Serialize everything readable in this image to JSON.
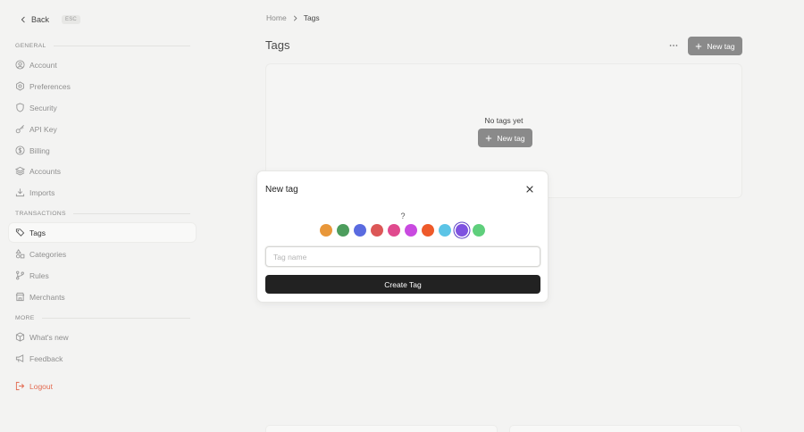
{
  "sidebar": {
    "back_label": "Back",
    "esc_label": "ESC",
    "sections": {
      "general": "GENERAL",
      "transactions": "TRANSACTIONS",
      "more": "MORE"
    },
    "items": {
      "account": {
        "label": "Account",
        "icon": "user-circle-icon"
      },
      "preferences": {
        "label": "Preferences",
        "icon": "gear-icon"
      },
      "security": {
        "label": "Security",
        "icon": "shield-icon"
      },
      "api_key": {
        "label": "API Key",
        "icon": "key-icon"
      },
      "billing": {
        "label": "Billing",
        "icon": "dollar-circle-icon"
      },
      "accounts": {
        "label": "Accounts",
        "icon": "layers-icon"
      },
      "imports": {
        "label": "Imports",
        "icon": "download-icon"
      },
      "tags": {
        "label": "Tags",
        "icon": "tag-icon"
      },
      "categories": {
        "label": "Categories",
        "icon": "shapes-icon"
      },
      "rules": {
        "label": "Rules",
        "icon": "git-branch-icon"
      },
      "merchants": {
        "label": "Merchants",
        "icon": "store-icon"
      },
      "whats_new": {
        "label": "What's new",
        "icon": "box-icon"
      },
      "feedback": {
        "label": "Feedback",
        "icon": "megaphone-icon"
      },
      "logout": {
        "label": "Logout",
        "icon": "logout-icon"
      }
    }
  },
  "breadcrumb": {
    "home": "Home",
    "current": "Tags"
  },
  "page": {
    "title": "Tags",
    "new_tag_label": "New tag",
    "empty_text": "No tags yet",
    "empty_new_tag_label": "New tag"
  },
  "modal": {
    "title": "New tag",
    "icon_placeholder": "?",
    "swatch_colors": [
      "#e8973a",
      "#4d9d5d",
      "#5a6be0",
      "#dc5757",
      "#e04a8e",
      "#c94ae0",
      "#ee5a2a",
      "#5cc4e6",
      "#7e52e0",
      "#5fcf7c"
    ],
    "selected_color": "#7e52e0",
    "input_placeholder": "Tag name",
    "input_value": "",
    "submit_label": "Create Tag"
  }
}
